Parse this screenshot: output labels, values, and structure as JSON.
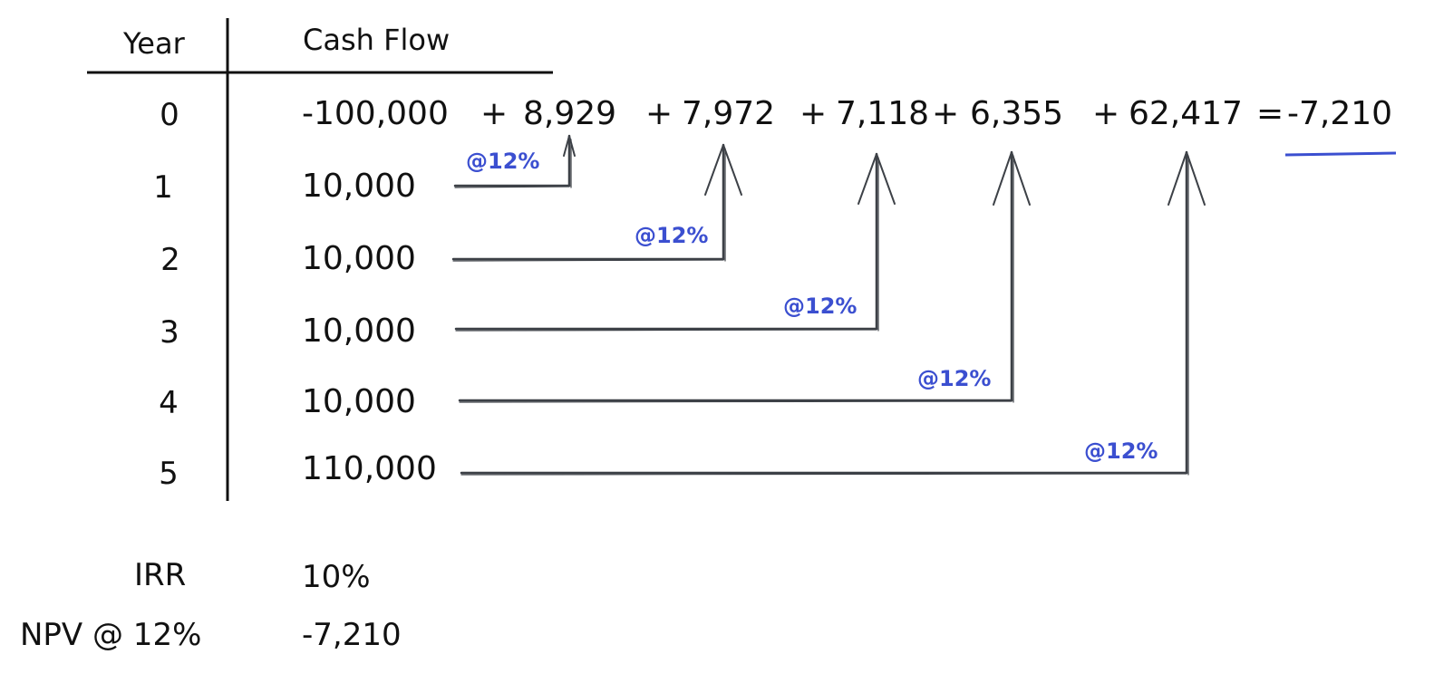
{
  "table": {
    "headers": {
      "year": "Year",
      "cash_flow": "Cash Flow"
    },
    "rows": [
      {
        "year": "0",
        "cash_flow": "-100,000"
      },
      {
        "year": "1",
        "cash_flow": "10,000"
      },
      {
        "year": "2",
        "cash_flow": "10,000"
      },
      {
        "year": "3",
        "cash_flow": "10,000"
      },
      {
        "year": "4",
        "cash_flow": "10,000"
      },
      {
        "year": "5",
        "cash_flow": "110,000"
      }
    ]
  },
  "equation": {
    "terms": [
      "8,929",
      "7,972",
      "7,118",
      "6,355",
      "62,417"
    ],
    "plus": "+",
    "equals": "=",
    "result": "-7,210"
  },
  "discount_label": "@12%",
  "summary": {
    "irr_label": "IRR",
    "irr_value": "10%",
    "npv_label": "NPV @ 12%",
    "npv_value": "-7,210"
  },
  "colors": {
    "ink": "#111111",
    "arrow": "#3d4147",
    "accent": "#3b4fd0"
  }
}
